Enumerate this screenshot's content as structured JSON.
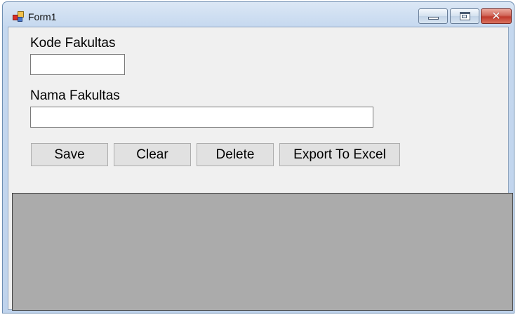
{
  "window": {
    "title": "Form1",
    "icons": {
      "app": "form-app-icon",
      "minimize": "minimize-icon",
      "maximize": "maximize-icon",
      "close": "close-icon"
    },
    "close_glyph": "✕"
  },
  "form": {
    "kode_label": "Kode Fakultas",
    "kode_value": "",
    "nama_label": "Nama Fakultas",
    "nama_value": ""
  },
  "buttons": {
    "save": "Save",
    "clear": "Clear",
    "delete": "Delete",
    "export": "Export To Excel"
  },
  "grid": {
    "background": "#ababab",
    "rows": []
  },
  "colors": {
    "client_bg": "#f0f0f0",
    "button_bg": "#e1e1e1",
    "close_red": "#c0392b"
  }
}
